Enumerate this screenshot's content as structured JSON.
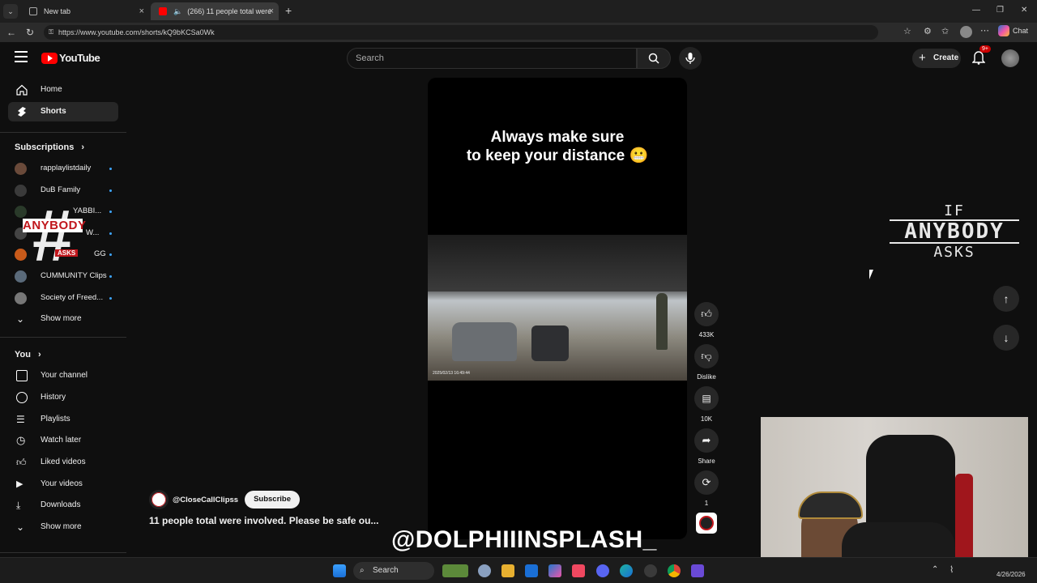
{
  "browser": {
    "tabs": [
      {
        "label": "New tab"
      },
      {
        "label": "(266) 11 people total were in..."
      }
    ],
    "url": "https://www.youtube.com/shorts/kQ9bKCSa0Wk",
    "chat_label": "Chat"
  },
  "youtube": {
    "logo": "YouTube",
    "search_placeholder": "Search",
    "create_label": "Create",
    "notif_badge": "9+"
  },
  "sidebar": {
    "main": [
      {
        "label": "Home",
        "icon": "home-icon"
      },
      {
        "label": "Shorts",
        "icon": "shorts-icon"
      }
    ],
    "subscriptions_header": "Subscriptions",
    "subscriptions": [
      {
        "label": "rapplaylistdaily"
      },
      {
        "label": "DuB Family"
      },
      {
        "label": "YABBI..."
      },
      {
        "label": "W..."
      },
      {
        "label": "GG"
      },
      {
        "label": "CUMMUNITY Clips"
      },
      {
        "label": "Society of Freed..."
      }
    ],
    "show_more_1": "Show more",
    "you_header": "You",
    "you_items": [
      {
        "label": "Your channel"
      },
      {
        "label": "History"
      },
      {
        "label": "Playlists"
      },
      {
        "label": "Watch later"
      },
      {
        "label": "Liked videos"
      },
      {
        "label": "Your videos"
      },
      {
        "label": "Downloads"
      }
    ],
    "show_more_2": "Show more"
  },
  "short": {
    "caption_line1": "Always make sure",
    "caption_line2": "to keep your distance 😬",
    "channel": "@CloseCallClipss",
    "subscribe_label": "Subscribe",
    "title": "11 people total were involved. Please be safe ou...",
    "actions": {
      "likes": "433K",
      "dislike": "Dislike",
      "comments": "10K",
      "share": "Share",
      "remix": "1"
    },
    "timestamp": "2025/02/13 16:49:44"
  },
  "overlay": {
    "watermark_line1": "IF",
    "watermark_line2": "ANYBODY",
    "watermark_line3": "ASKS",
    "sidebar_logo": "ANYBODY",
    "sidebar_logo_sub": "ASKS",
    "handle": "@DOLPHIIINSPLASH_"
  },
  "taskbar": {
    "search_label": "Search",
    "date": "4/26/2026"
  }
}
